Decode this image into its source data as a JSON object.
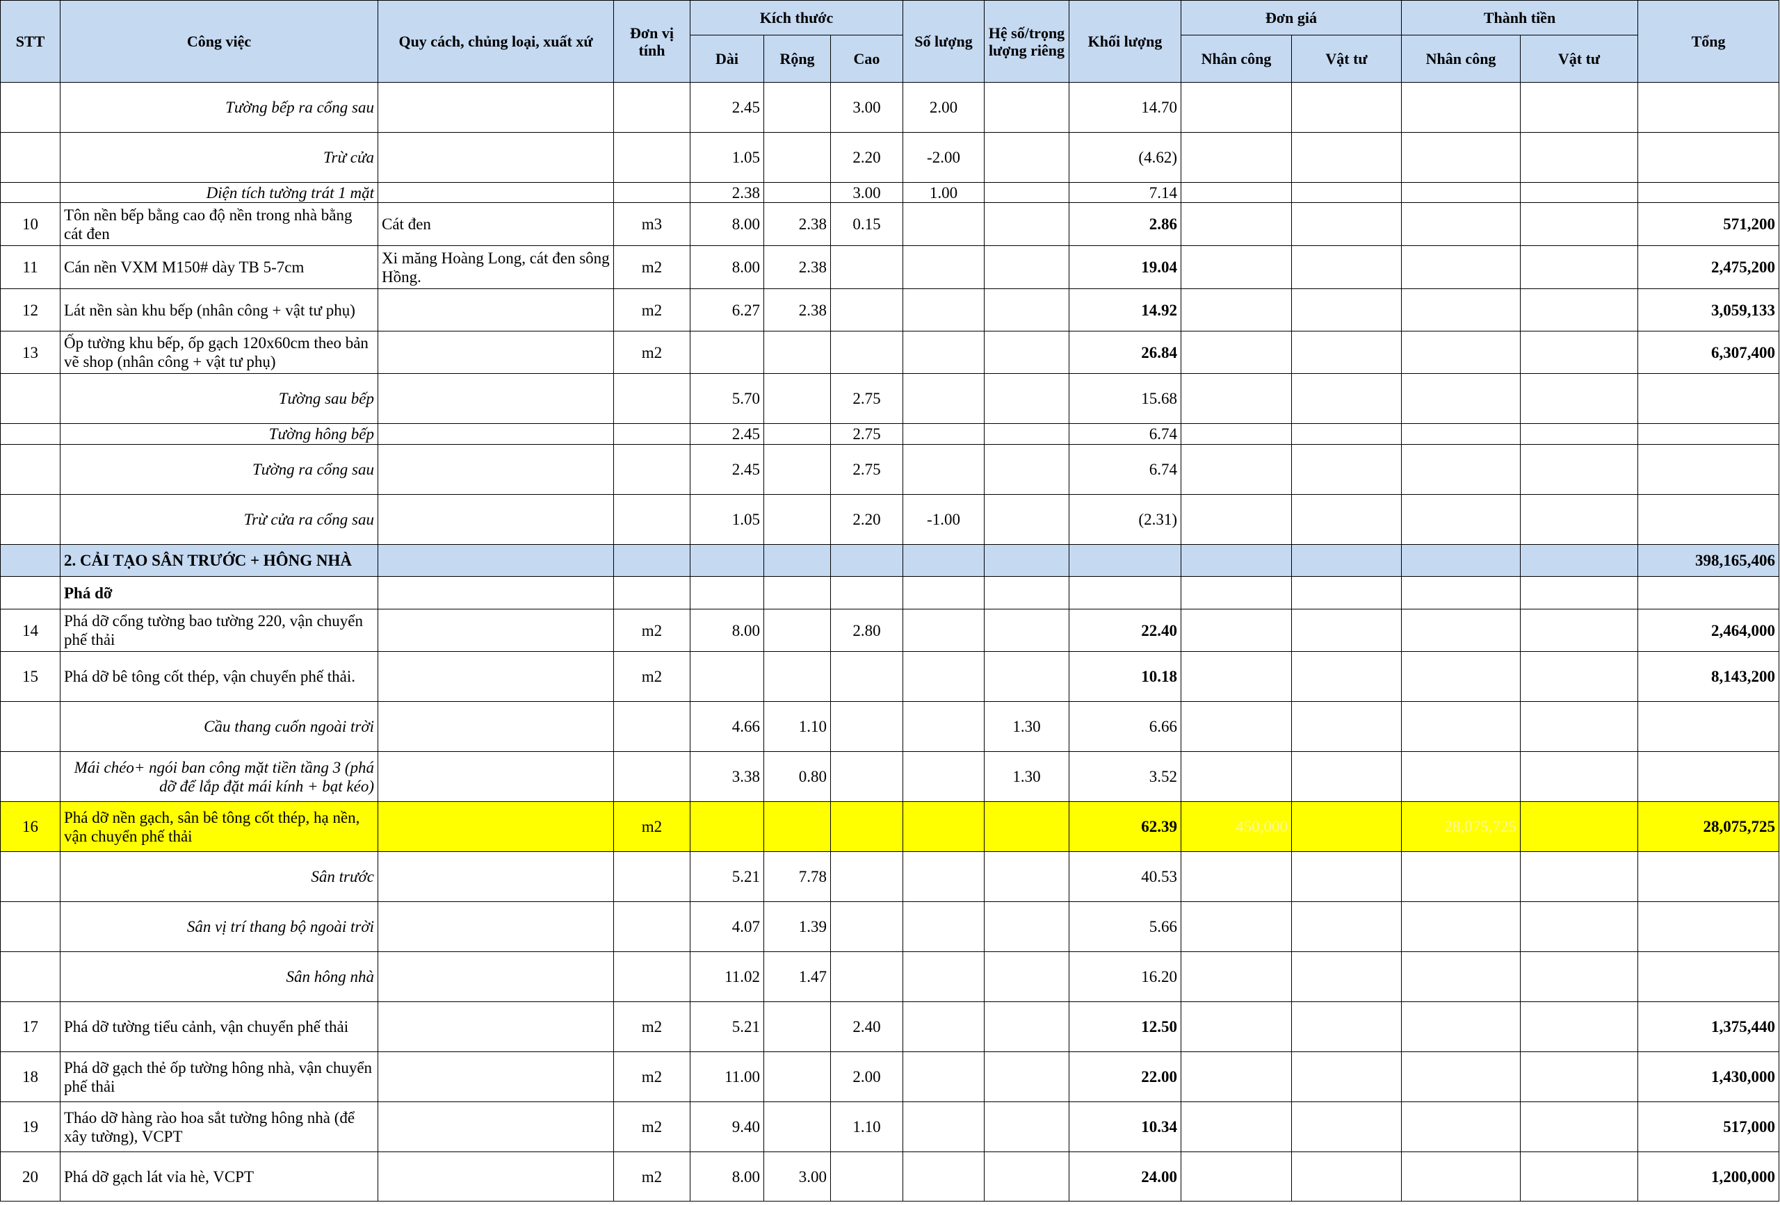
{
  "header": {
    "stt": "STT",
    "cong_viec": "Công việc",
    "quy_cach": "Quy cách, chủng loại, xuất xứ",
    "don_vi": "Đơn vị tính",
    "kich_thuoc": "Kích thước",
    "dai": "Dài",
    "rong": "Rộng",
    "cao": "Cao",
    "so_luong": "Số lượng",
    "he_so": "Hệ số/trọng lượng riêng",
    "khoi_luong": "Khối lượng",
    "don_gia": "Đơn giá",
    "thanh_tien": "Thành tiền",
    "nhan_cong": "Nhân công",
    "vat_tu": "Vật tư",
    "tong": "Tổng"
  },
  "colors": {
    "header_bg": "#c5d9f1",
    "highlight_bg": "#ffff00"
  },
  "rows": [
    {
      "kind": "sub",
      "h": 72,
      "name": "Tường bếp ra cổng sau",
      "dai": "2.45",
      "cao": "3.00",
      "so_luong": "2.00",
      "khoi_luong": "14.70"
    },
    {
      "kind": "sub",
      "h": 72,
      "name": "Trừ cửa",
      "dai": "1.05",
      "cao": "2.20",
      "so_luong": "-2.00",
      "khoi_luong": "(4.62)"
    },
    {
      "kind": "sub",
      "h": 29,
      "name": "Diện tích tường trát 1 mặt",
      "dai": "2.38",
      "cao": "3.00",
      "so_luong": "1.00",
      "khoi_luong": "7.14"
    },
    {
      "kind": "item",
      "h": 62,
      "stt": "10",
      "name": "Tôn nền bếp bằng cao độ nền trong nhà bằng cát đen",
      "spec": "Cát đen",
      "unit": "m3",
      "dai": "8.00",
      "rong": "2.38",
      "cao": "0.15",
      "khoi_luong": "2.86",
      "tong": "571,200"
    },
    {
      "kind": "item",
      "h": 62,
      "stt": "11",
      "name": "Cán nền VXM M150# dày TB 5-7cm",
      "spec": "Xi măng Hoàng Long, cát đen sông Hồng.",
      "unit": "m2",
      "dai": "8.00",
      "rong": "2.38",
      "khoi_luong": "19.04",
      "tong": "2,475,200"
    },
    {
      "kind": "item",
      "h": 61,
      "stt": "12",
      "name": "Lát nền sàn khu bếp (nhân công + vật tư phụ)",
      "unit": "m2",
      "dai": "6.27",
      "rong": "2.38",
      "khoi_luong": "14.92",
      "tong": "3,059,133"
    },
    {
      "kind": "item",
      "h": 61,
      "stt": "13",
      "name": "Ốp tường khu bếp, ốp gạch 120x60cm theo bản vẽ shop (nhân công + vật tư phụ)",
      "unit": "m2",
      "khoi_luong": "26.84",
      "tong": "6,307,400"
    },
    {
      "kind": "sub",
      "h": 72,
      "name": "Tường sau bếp",
      "dai": "5.70",
      "cao": "2.75",
      "khoi_luong": "15.68"
    },
    {
      "kind": "sub",
      "h": 30,
      "name": "Tường hông bếp",
      "dai": "2.45",
      "cao": "2.75",
      "khoi_luong": "6.74"
    },
    {
      "kind": "sub",
      "h": 72,
      "name": "Tường ra cổng sau",
      "dai": "2.45",
      "cao": "2.75",
      "khoi_luong": "6.74"
    },
    {
      "kind": "sub",
      "h": 72,
      "name": "Trừ cửa ra cổng sau",
      "dai": "1.05",
      "cao": "2.20",
      "so_luong": "-1.00",
      "khoi_luong": "(2.31)"
    },
    {
      "kind": "section",
      "h": 46,
      "name": "2. CẢI TẠO SÂN TRƯỚC + HÔNG NHÀ",
      "tong": "398,165,406"
    },
    {
      "kind": "group",
      "h": 47,
      "name": "Phá dỡ"
    },
    {
      "kind": "item",
      "h": 61,
      "stt": "14",
      "name": "Phá dỡ cổng tường bao tường 220, vận chuyển phế thải",
      "unit": "m2",
      "dai": "8.00",
      "cao": "2.80",
      "khoi_luong": "22.40",
      "tong": "2,464,000"
    },
    {
      "kind": "item",
      "h": 72,
      "stt": "15",
      "name": "Phá dỡ bê tông cốt thép, vận chuyển phế thải.",
      "unit": "m2",
      "khoi_luong": "10.18",
      "tong": "8,143,200"
    },
    {
      "kind": "sub",
      "h": 72,
      "name": "Cầu thang cuốn ngoài trời",
      "dai": "4.66",
      "rong": "1.10",
      "he_so": "1.30",
      "khoi_luong": "6.66"
    },
    {
      "kind": "sub",
      "h": 72,
      "name": "Mái chéo+ ngói ban công mặt tiền tầng 3 (phá dỡ để lắp đặt mái kính + bạt kéo)",
      "dai": "3.38",
      "rong": "0.80",
      "he_so": "1.30",
      "khoi_luong": "3.52"
    },
    {
      "kind": "highlight",
      "h": 72,
      "stt": "16",
      "name": "Phá dỡ nền gạch, sân bê tông cốt thép, hạ nền, vận chuyển phế thải",
      "unit": "m2",
      "khoi_luong": "62.39",
      "nc_gia": "450,000",
      "nc_tien": "28,075,725",
      "tong": "28,075,725"
    },
    {
      "kind": "sub",
      "h": 72,
      "name": "Sân trước",
      "dai": "5.21",
      "rong": "7.78",
      "khoi_luong": "40.53"
    },
    {
      "kind": "sub",
      "h": 72,
      "name": "Sân vị trí thang bộ ngoài trời",
      "dai": "4.07",
      "rong": "1.39",
      "khoi_luong": "5.66"
    },
    {
      "kind": "sub",
      "h": 72,
      "name": "Sân hông nhà",
      "dai": "11.02",
      "rong": "1.47",
      "khoi_luong": "16.20"
    },
    {
      "kind": "item",
      "h": 72,
      "stt": "17",
      "name": "Phá dỡ tường tiểu cảnh, vận chuyển phế thải",
      "unit": "m2",
      "dai": "5.21",
      "cao": "2.40",
      "khoi_luong": "12.50",
      "tong": "1,375,440"
    },
    {
      "kind": "item",
      "h": 72,
      "stt": "18",
      "name": "Phá dỡ gạch thẻ ốp tường hông nhà, vận chuyển phế thải",
      "unit": "m2",
      "dai": "11.00",
      "cao": "2.00",
      "khoi_luong": "22.00",
      "tong": "1,430,000"
    },
    {
      "kind": "item",
      "h": 72,
      "stt": "19",
      "name": "Tháo dỡ hàng rào hoa sắt tường hông nhà (để xây tường), VCPT",
      "unit": "m2",
      "dai": "9.40",
      "cao": "1.10",
      "khoi_luong": "10.34",
      "tong": "517,000"
    },
    {
      "kind": "item",
      "h": 71,
      "stt": "20",
      "name": "Phá dỡ gạch lát vỉa hè, VCPT",
      "unit": "m2",
      "dai": "8.00",
      "rong": "3.00",
      "khoi_luong": "24.00",
      "tong": "1,200,000"
    }
  ]
}
